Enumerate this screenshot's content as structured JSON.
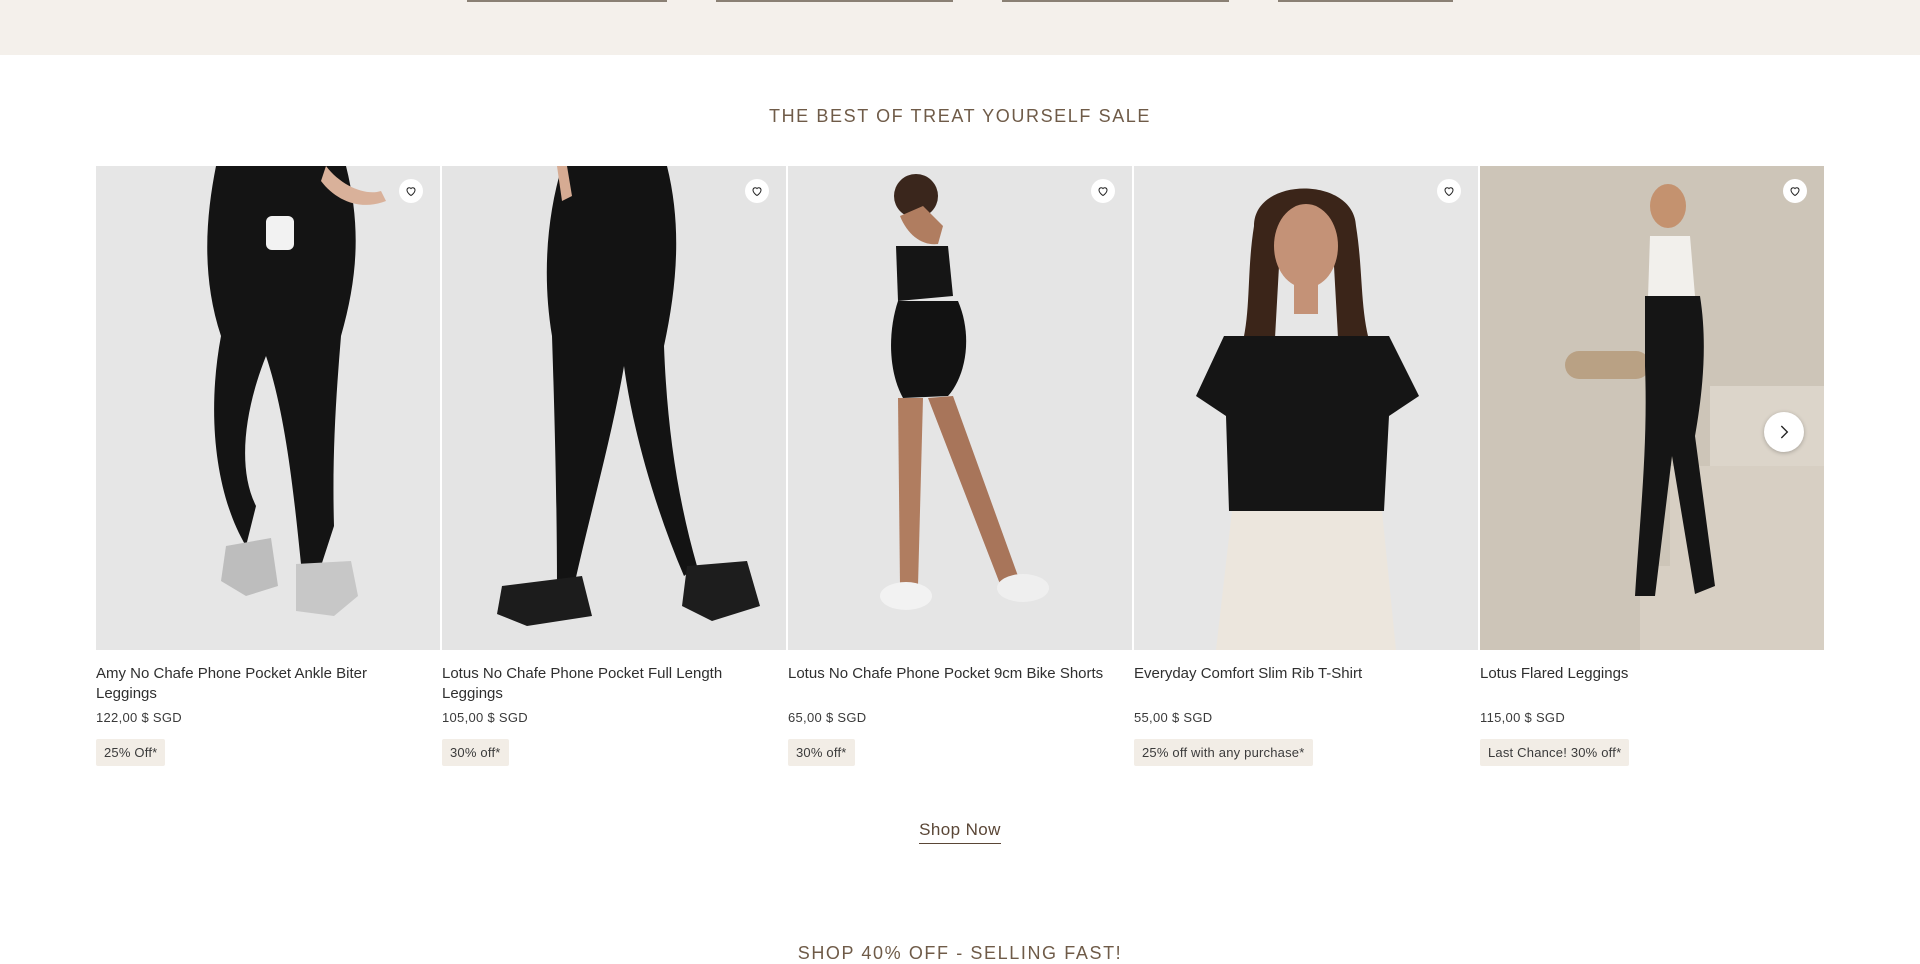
{
  "section": {
    "title": "THE BEST OF TREAT YOURSELF SALE"
  },
  "products": [
    {
      "name": "Amy No Chafe Phone Pocket Ankle Biter Leggings",
      "price": "122,00 $ SGD",
      "badge": "25% Off*"
    },
    {
      "name": "Lotus No Chafe Phone Pocket Full Length Leggings",
      "price": "105,00 $ SGD",
      "badge": "30% off*"
    },
    {
      "name": "Lotus No Chafe Phone Pocket 9cm Bike Shorts",
      "price": "65,00 $ SGD",
      "badge": "30% off*"
    },
    {
      "name": "Everyday Comfort Slim Rib T-Shirt",
      "price": "55,00 $ SGD",
      "badge": "25% off with any purchase*"
    },
    {
      "name": "Lotus Flared Leggings",
      "price": "115,00 $ SGD",
      "badge": "Last Chance! 30% off*"
    }
  ],
  "cta": {
    "shop_now": "Shop Now"
  },
  "next_section": {
    "title": "SHOP 40% OFF - SELLING FAST!"
  },
  "icons": {
    "wishlist": "heart-icon",
    "next": "chevron-right-icon"
  },
  "colors": {
    "band": "#f4f0eb",
    "title": "#6f5b48",
    "badge_bg": "#f2ede6"
  }
}
